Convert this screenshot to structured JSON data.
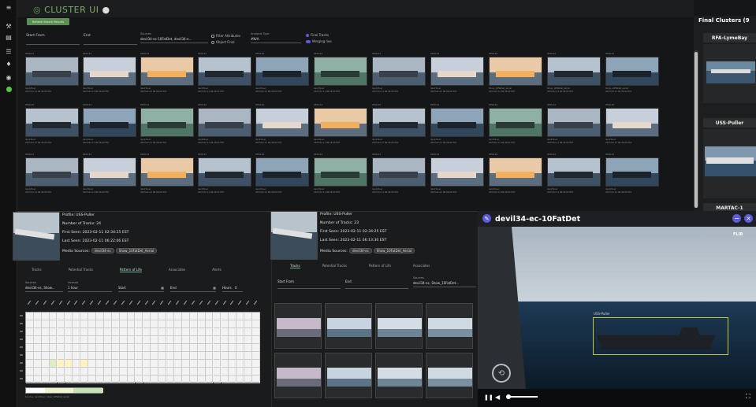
{
  "app": {
    "title": "CLUSTER UI",
    "refresh_label": "Refresh Search Results"
  },
  "filters": {
    "start_label": "Start From",
    "end_label": "End",
    "sources_label": "Sources",
    "sources_value": "devil34-ec-10FatDet, devil34-e...",
    "filter_attributes": "Filter Attributes",
    "object_final": "Object Final",
    "analysis_label": "Analysis Type",
    "analysis_value": "#N/A",
    "final_tracks": "Final Tracks",
    "merging_live": "Merging live"
  },
  "grid": {
    "cell_header": "DEVIL34",
    "caption_source": "devil34-ec",
    "caption_date": "2023-02-11 06:26:02 EST",
    "caption_alt": "Show_10FatDet_Aerial"
  },
  "clusters": {
    "title": "Final Clusters (9",
    "items": [
      "RFA-LymeBay",
      "USS-Puller",
      "MARTAC-1"
    ]
  },
  "profile_left": {
    "profile": "Profile: USS-Puller",
    "tracks": "Number of Tracks: 24",
    "first_seen": "First Seen: 2023-02-11 02:34:25 EST",
    "last_seen": "Last Seen: 2023-02-11 06:22:06 EST",
    "media_label": "Media Sources:",
    "media": [
      "devil34-ec",
      "Show_10FatDet_Aerial"
    ],
    "tabs": [
      "Tracks",
      "Potential Tracks",
      "Pattern of Life",
      "Associates",
      "Alerts"
    ],
    "active_tab": "Pattern of Life",
    "sources_label": "Sources",
    "sources_value": "devil34-ec, Show...",
    "interval_label": "Interval",
    "interval_value": "1 hour",
    "start_label": "Start",
    "end_label": "End",
    "hours_label": "Hours",
    "hours_value": "0",
    "legend": "Sources: devil34-ec, Show_10FatDet_Aerial"
  },
  "profile_mid": {
    "profile": "Profile: USS-Puller",
    "tracks": "Number of Tracks: 23",
    "first_seen": "First Seen: 2023-02-11 02:34:25 EST",
    "last_seen": "Last Seen: 2023-02-11 06:13:30 EST",
    "media_label": "Media Sources:",
    "media": [
      "devil34-ec",
      "Show_10FatDet_Aerial"
    ],
    "tabs": [
      "Tracks",
      "Potential Tracks",
      "Pattern of Life",
      "Associates"
    ],
    "active_tab": "Tracks",
    "start_label": "Start From",
    "end_label": "End",
    "sources_label": "Sources",
    "sources_value": "devil34-ec, Show_10FatDet..."
  },
  "video": {
    "title": "devil34-ec-10FatDet",
    "detection_label": "USS-Puller",
    "watermark": "FLIR"
  }
}
